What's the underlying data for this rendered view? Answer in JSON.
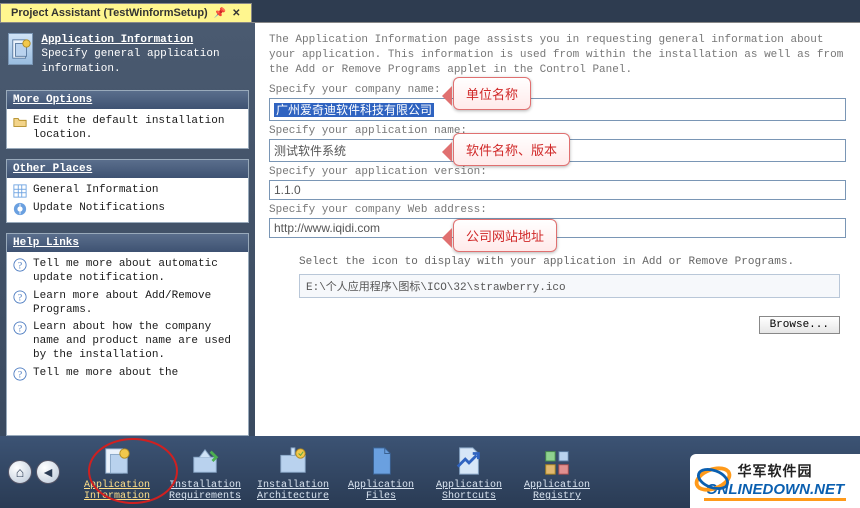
{
  "tab": {
    "title": "Project Assistant (TestWinformSetup)"
  },
  "sideHeader": {
    "title": "Application Information",
    "desc": "Specify general application information."
  },
  "panels": {
    "moreOptions": {
      "title": "More Options",
      "items": [
        {
          "icon": "folder-icon",
          "label": "Edit the default installation location."
        }
      ]
    },
    "otherPlaces": {
      "title": "Other Places",
      "items": [
        {
          "icon": "grid-icon",
          "label": "General Information"
        },
        {
          "icon": "update-icon",
          "label": "Update Notifications"
        }
      ]
    },
    "helpLinks": {
      "title": "Help Links",
      "items": [
        {
          "icon": "help-icon",
          "label": "Tell me more about automatic update notification."
        },
        {
          "icon": "help-icon",
          "label": "Learn more about Add/Remove Programs."
        },
        {
          "icon": "help-icon",
          "label": "Learn about how the company name and product name are used by the installation."
        },
        {
          "icon": "help-icon",
          "label": "Tell me more about the"
        }
      ]
    }
  },
  "content": {
    "intro": "The Application Information page assists you in requesting general information about your application. This information is used from within the installation as well as from the Add or Remove Programs applet in the Control Panel.",
    "companyLabel": "Specify your company name:",
    "companyValue": "广州爱奇迪软件科技有限公司",
    "appNameLabel": "Specify your application name:",
    "appNameValue": "测试软件系统",
    "appVersionLabel": "Specify your application version:",
    "appVersionValue": "1.1.0",
    "webLabel": "Specify your company Web address:",
    "webValue": "http://www.iqidi.com",
    "iconSelectLabel": "Select the icon to display with your application in Add or Remove Programs.",
    "iconPath": "E:\\个人应用程序\\图标\\ICO\\32\\strawberry.ico",
    "browseLabel": "Browse..."
  },
  "callouts": {
    "c1": "单位名称",
    "c2": "软件名称、版本",
    "c3": "公司网站地址"
  },
  "bottom": {
    "items": [
      {
        "label": "Application Information",
        "icon": "app-info-icon",
        "selected": true
      },
      {
        "label": "Installation Requirements",
        "icon": "requirements-icon"
      },
      {
        "label": "Installation Architecture",
        "icon": "architecture-icon"
      },
      {
        "label": "Application Files",
        "icon": "files-icon"
      },
      {
        "label": "Application Shortcuts",
        "icon": "shortcuts-icon"
      },
      {
        "label": "Application Registry",
        "icon": "registry-icon"
      }
    ]
  },
  "watermark": {
    "cn": "华军软件园",
    "en": "ONLINEDOWN.NET"
  }
}
